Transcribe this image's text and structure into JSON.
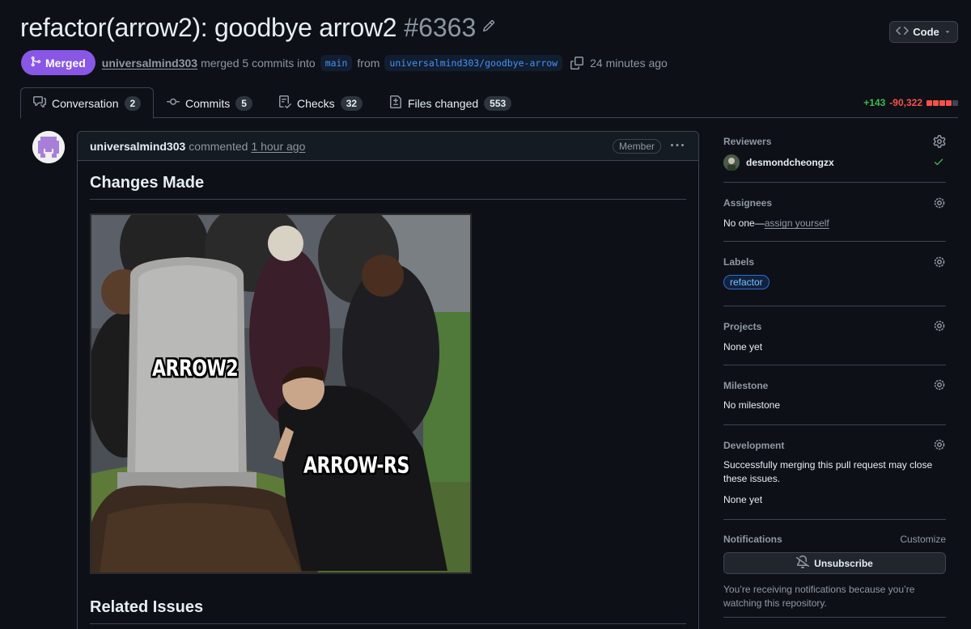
{
  "header": {
    "title": "refactor(arrow2): goodbye arrow2",
    "number": "#6363",
    "code_button": "Code"
  },
  "meta": {
    "status": "Merged",
    "author": "universalmind303",
    "action": "merged 5 commits into",
    "base_branch": "main",
    "from_text": "from",
    "head_branch": "universalmind303/goodbye-arrow",
    "time": "24 minutes ago"
  },
  "tabs": [
    {
      "label": "Conversation",
      "count": "2"
    },
    {
      "label": "Commits",
      "count": "5"
    },
    {
      "label": "Checks",
      "count": "32"
    },
    {
      "label": "Files changed",
      "count": "553"
    }
  ],
  "diffstat": {
    "additions": "+143",
    "deletions": "-90,322"
  },
  "comment": {
    "author": "universalmind303",
    "action": "commented",
    "time": "1 hour ago",
    "badge": "Member",
    "heading_changes": "Changes Made",
    "meme_tombstone": "ARROW2",
    "meme_person": "ARROW-RS",
    "heading_related": "Related Issues"
  },
  "sidebar": {
    "reviewers": {
      "title": "Reviewers",
      "name": "desmondcheongzx"
    },
    "assignees": {
      "title": "Assignees",
      "none": "No one—",
      "link": "assign yourself"
    },
    "labels": {
      "title": "Labels",
      "label": "refactor"
    },
    "projects": {
      "title": "Projects",
      "value": "None yet"
    },
    "milestone": {
      "title": "Milestone",
      "value": "No milestone"
    },
    "development": {
      "title": "Development",
      "text": "Successfully merging this pull request may close these issues.",
      "value": "None yet"
    },
    "notifications": {
      "title": "Notifications",
      "customize": "Customize",
      "button": "Unsubscribe",
      "note": "You’re receiving notifications because you’re watching this repository."
    }
  },
  "colors": {
    "merged": "#8957e5",
    "additions": "#3fb950",
    "deletions": "#f85149",
    "link": "#4493f8"
  }
}
